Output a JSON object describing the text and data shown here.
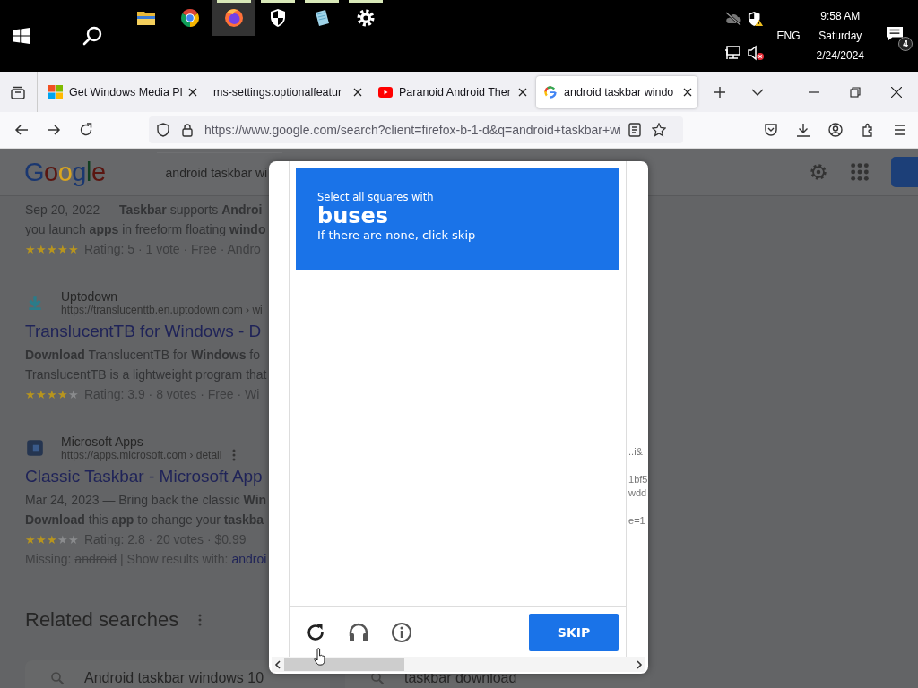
{
  "taskbar": {
    "apps": [
      {
        "kind": "folder",
        "running": false,
        "active": false
      },
      {
        "kind": "round-logo",
        "running": false,
        "active": false
      },
      {
        "kind": "fox",
        "running": true,
        "active": true
      },
      {
        "kind": "shield",
        "running": true,
        "active": false
      },
      {
        "kind": "notepad",
        "running": true,
        "active": false
      },
      {
        "kind": "gear",
        "running": true,
        "active": false
      }
    ],
    "tray": {
      "language": "ENG",
      "time": "9:58 AM",
      "day": "Saturday",
      "date": "2/24/2024",
      "notifications": "4"
    }
  },
  "browser": {
    "tabs": [
      {
        "kind": "windows",
        "title": "Get Windows Media Pl",
        "selected": false
      },
      {
        "title": "ms-settings:optionalfeatur",
        "selected": false
      },
      {
        "kind": "video",
        "title": "Paranoid Android Ther",
        "selected": false
      },
      {
        "kind": "google",
        "title": "android taskbar windo",
        "selected": true
      }
    ],
    "url": "https://www.google.com/search?client=firefox-b-1-d&q=android+taskbar+wi"
  },
  "page": {
    "logo": "Google",
    "search_query": "android taskbar wi",
    "results": [
      {
        "snippet": [
          "Sep 20, 2022 — **Taskbar** supports **Androi**",
          "you launch **apps** in freeform floating **windo**"
        ],
        "stars": 5,
        "rating": "Rating: 5 · 1 vote · Free · Andro"
      },
      {
        "site": "Uptodown",
        "url": "https://translucenttb.en.uptodown.com › wi",
        "title": "TranslucentTB for Windows - D",
        "snippet": [
          "**Download** TranslucentTB for **Windows** fo",
          "TranslucentTB is a lightweight program that"
        ],
        "stars": 4,
        "rating": "Rating: 3.9 · 8 votes · Free · Wi"
      },
      {
        "site": "Microsoft Apps",
        "url": "https://apps.microsoft.com › detail",
        "title": "Classic Taskbar - Microsoft App",
        "snippet": [
          "Mar 24, 2023 — Bring back the classic **Win**",
          "**Download** this **app** to change your **taskba**"
        ],
        "stars": 3,
        "rating": "Rating: 2.8 · 20 votes · $0.99",
        "missing": {
          "label": "Missing:",
          "word": "android",
          "show": "| Show results with:",
          "link": "androi"
        }
      }
    ],
    "related_title": "Related searches",
    "related": [
      {
        "text": "Android taskbar windows 10"
      },
      {
        "text": "taskbar download"
      }
    ]
  },
  "captcha": {
    "prompt": "Select all squares with",
    "target": "buses",
    "hint": "If there are none, click skip",
    "button": "SKIP",
    "fragments": [
      "..i&",
      "1bf5",
      "wdd",
      "e=1"
    ]
  }
}
